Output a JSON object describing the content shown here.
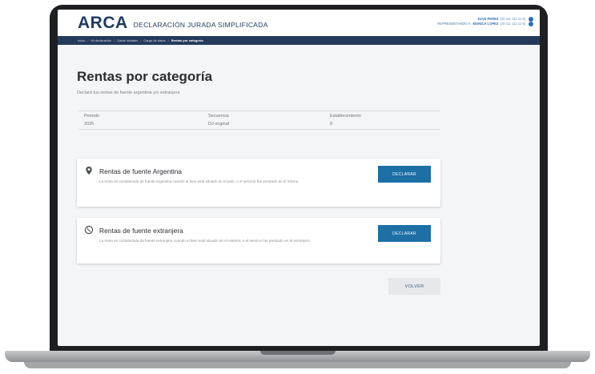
{
  "header": {
    "brand": "ARCA",
    "app_title": "DECLARACIÓN JURADA SIMPLIFICADA",
    "user_name": "JUAN PEREZ",
    "user_cuit": "[20-111 111 11-6]",
    "rep_label": "REPRESENTANDO A:",
    "rep_name": "MONICA LOPEZ",
    "rep_cuit": "[20-111 111 11-6]"
  },
  "breadcrumb": [
    "Inicio",
    "Mi declaración",
    "Datos iniciales",
    "Carga de datos",
    "Rentas por categoría"
  ],
  "page": {
    "title": "Rentas por categoría",
    "subtitle": "Declará tus rentas de fuente argentina y/o extranjera"
  },
  "info": {
    "periodo_label": "Periodo",
    "periodo_value": "2025",
    "secuencia_label": "Secuencia",
    "secuencia_value": "DJ original",
    "establecimiento_label": "Establecimiento",
    "establecimiento_value": "0"
  },
  "cards": [
    {
      "title": "Rentas de fuente Argentina",
      "description": "La renta es considerada de fuente argentina cuando el bien está situado en el país, o el servicio fue prestado en el mismo.",
      "button": "DECLARAR",
      "icon": "location-pin-icon"
    },
    {
      "title": "Rentas de fuente extranjera",
      "description": "La renta es considerada de fuente extranjera cuando el bien está situado en el exterior, o el servicio fue prestado en el extranjero.",
      "button": "DECLARAR",
      "icon": "globe-icon"
    }
  ],
  "actions": {
    "back_label": "VOLVER"
  },
  "colors": {
    "brand": "#1f3a5f",
    "nav_bar": "#253b5c",
    "primary_button": "#1d6fa5",
    "secondary_button": "#e6e8eb"
  }
}
